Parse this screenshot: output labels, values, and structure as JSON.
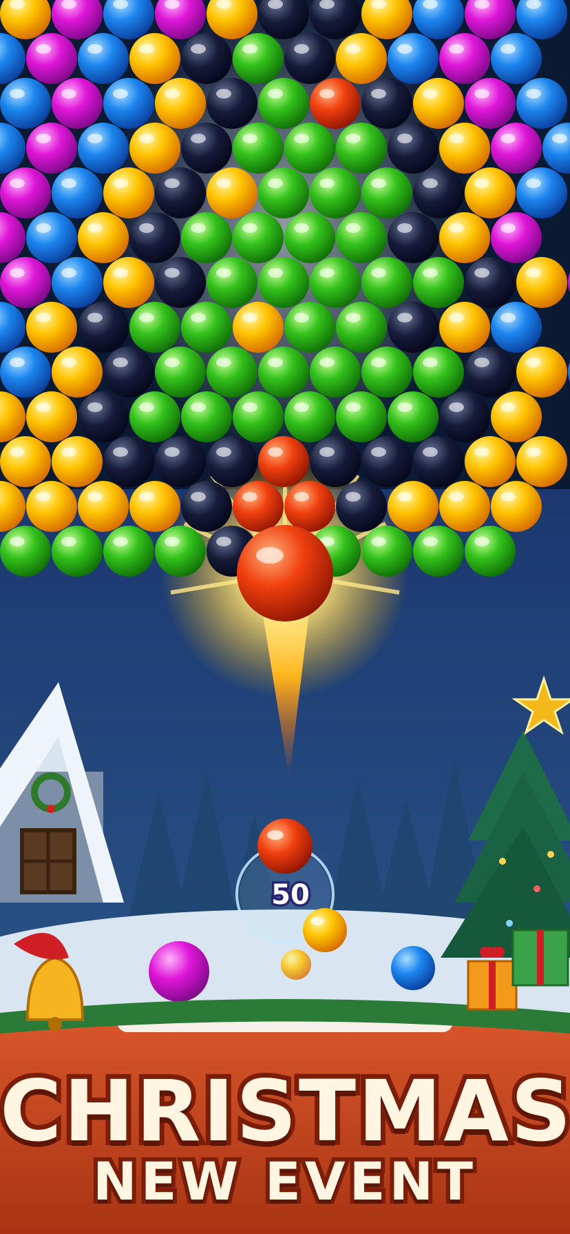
{
  "banner": {
    "title": "CHRISTMAS",
    "subtitle": "NEW EVENT"
  },
  "shooter": {
    "bubbles_remaining": "50",
    "current_bubble_color": "red",
    "next_bubble_color": "yellow"
  },
  "colors": {
    "red": "#e8340e",
    "yellow": "#ffc200",
    "green": "#2fc21d",
    "blue": "#1e83ee",
    "magenta": "#df16d8",
    "black": "#0a0f2a",
    "banner_bg": "#c4451d",
    "banner_text": "#fff5e1"
  },
  "bubble_grid": {
    "rows": [
      "yMbMyKKybMb",
      "bMbyKGKybMb",
      "bMbyKGRKyMb",
      "bMbyKGGGKyMb",
      "MbyKYGGGKyb",
      "MbyKGGGGKyM",
      "MbyKGGGGGKyM",
      "byKGGYGGKyb",
      "byKGGGGGGKyb",
      "yyKGGGGGGKy",
      "yyKKKRKKKyy",
      "yyyyKRRKyyy",
      "GGGGKRGGGG"
    ]
  }
}
